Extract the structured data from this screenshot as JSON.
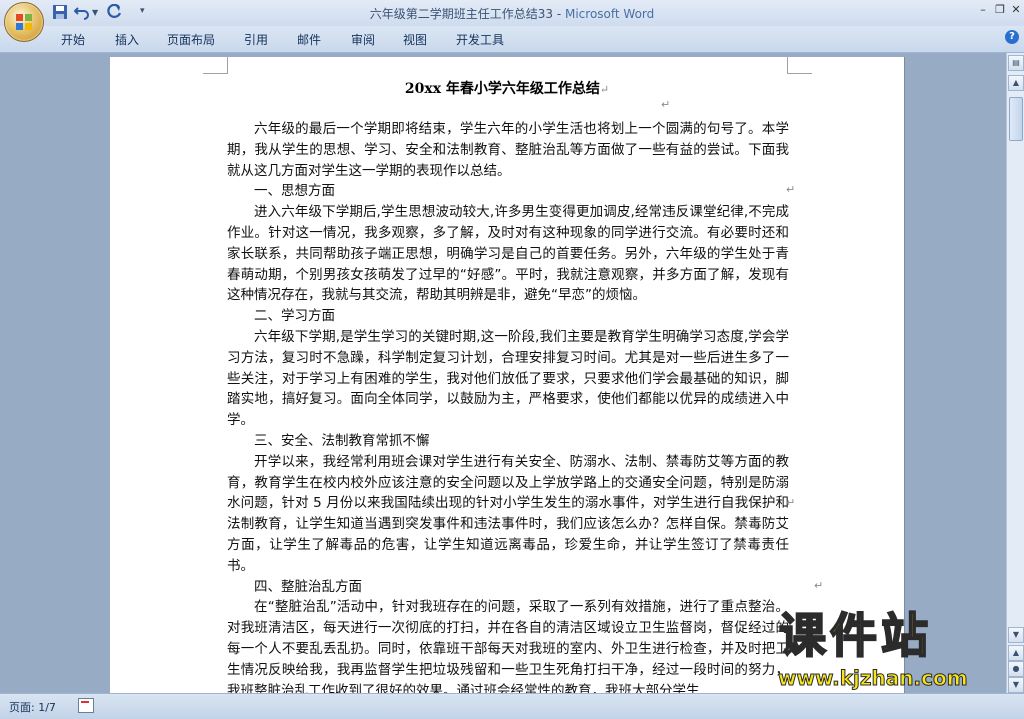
{
  "window": {
    "doc_name": "六年级第二学期班主任工作总结33",
    "separator": " - ",
    "app_name": "Microsoft Word"
  },
  "ribbon": {
    "tabs": [
      "开始",
      "插入",
      "页面布局",
      "引用",
      "邮件",
      "审阅",
      "视图",
      "开发工具"
    ],
    "help": "?"
  },
  "document": {
    "title": "20xx 年春小学六年级工作总结",
    "paragraphs": [
      {
        "type": "para",
        "text": "六年级的最后一个学期即将结束，学生六年的小学生活也将划上一个圆满的句号了。本学期，我从学生的思想、学习、安全和法制教育、整脏治乱等方面做了一些有益的尝试。下面我就从这几方面对学生这一学期的表现作以总结。"
      },
      {
        "type": "head",
        "text": "一、思想方面"
      },
      {
        "type": "para",
        "text": "进入六年级下学期后,学生思想波动较大,许多男生变得更加调皮,经常违反课堂纪律,不完成作业。针对这一情况，我多观察，多了解，及时对有这种现象的同学进行交流。有必要时还和家长联系，共同帮助孩子端正思想，明确学习是自己的首要任务。另外，六年级的学生处于青春萌动期，个别男孩女孩萌发了过早的“好感”。平时，我就注意观察，并多方面了解，发现有这种情况存在，我就与其交流，帮助其明辨是非，避免“早恋”的烦恼。"
      },
      {
        "type": "head",
        "text": "二、学习方面"
      },
      {
        "type": "para",
        "text": "六年级下学期,是学生学习的关键时期,这一阶段,我们主要是教育学生明确学习态度,学会学习方法，复习时不急躁，科学制定复习计划，合理安排复习时间。尤其是对一些后进生多了一些关注，对于学习上有困难的学生，我对他们放低了要求，只要求他们学会最基础的知识，脚踏实地，搞好复习。面向全体同学，以鼓励为主，严格要求，使他们都能以优异的成绩进入中学。"
      },
      {
        "type": "head",
        "text": "三、安全、法制教育常抓不懈"
      },
      {
        "type": "para",
        "text": "开学以来，我经常利用班会课对学生进行有关安全、防溺水、法制、禁毒防艾等方面的教育，教育学生在校内校外应该注意的安全问题以及上学放学路上的交通安全问题，特别是防溺水问题，针对 5 月份以来我国陆续出现的针对小学生发生的溺水事件，对学生进行自我保护和法制教育，让学生知道当遇到突发事件和违法事件时，我们应该怎么办？怎样自保。禁毒防艾方面，让学生了解毒品的危害，让学生知道远离毒品，珍爱生命，并让学生签订了禁毒责任书。"
      },
      {
        "type": "head",
        "text": "四、整脏治乱方面"
      },
      {
        "type": "para",
        "text": "在“整脏治乱”活动中，针对我班存在的问题，采取了一系列有效措施，进行了重点整治。对我班清洁区，每天进行一次彻底的打扫，并在各自的清洁区域设立卫生监督岗，督促经过的每一个人不要乱丢乱扔。同时，依靠班干部每天对我班的室内、外卫生进行检查，并及时把卫生情况反映给我，我再监督学生把垃圾残留和一些卫生死角打扫干净，经过一段时间的努力，我班整脏治乱工作收到了很好的效果。通过班会经常性的教育，我班大部分学生"
      }
    ]
  },
  "status": {
    "page": "页面: 1/7"
  },
  "watermark": {
    "text": "课件站",
    "url": "www.kjzhan.com"
  },
  "colors": {
    "accent": "#2a6fcf",
    "workspace": "#97abc5",
    "watermark": "#f7e41a"
  }
}
